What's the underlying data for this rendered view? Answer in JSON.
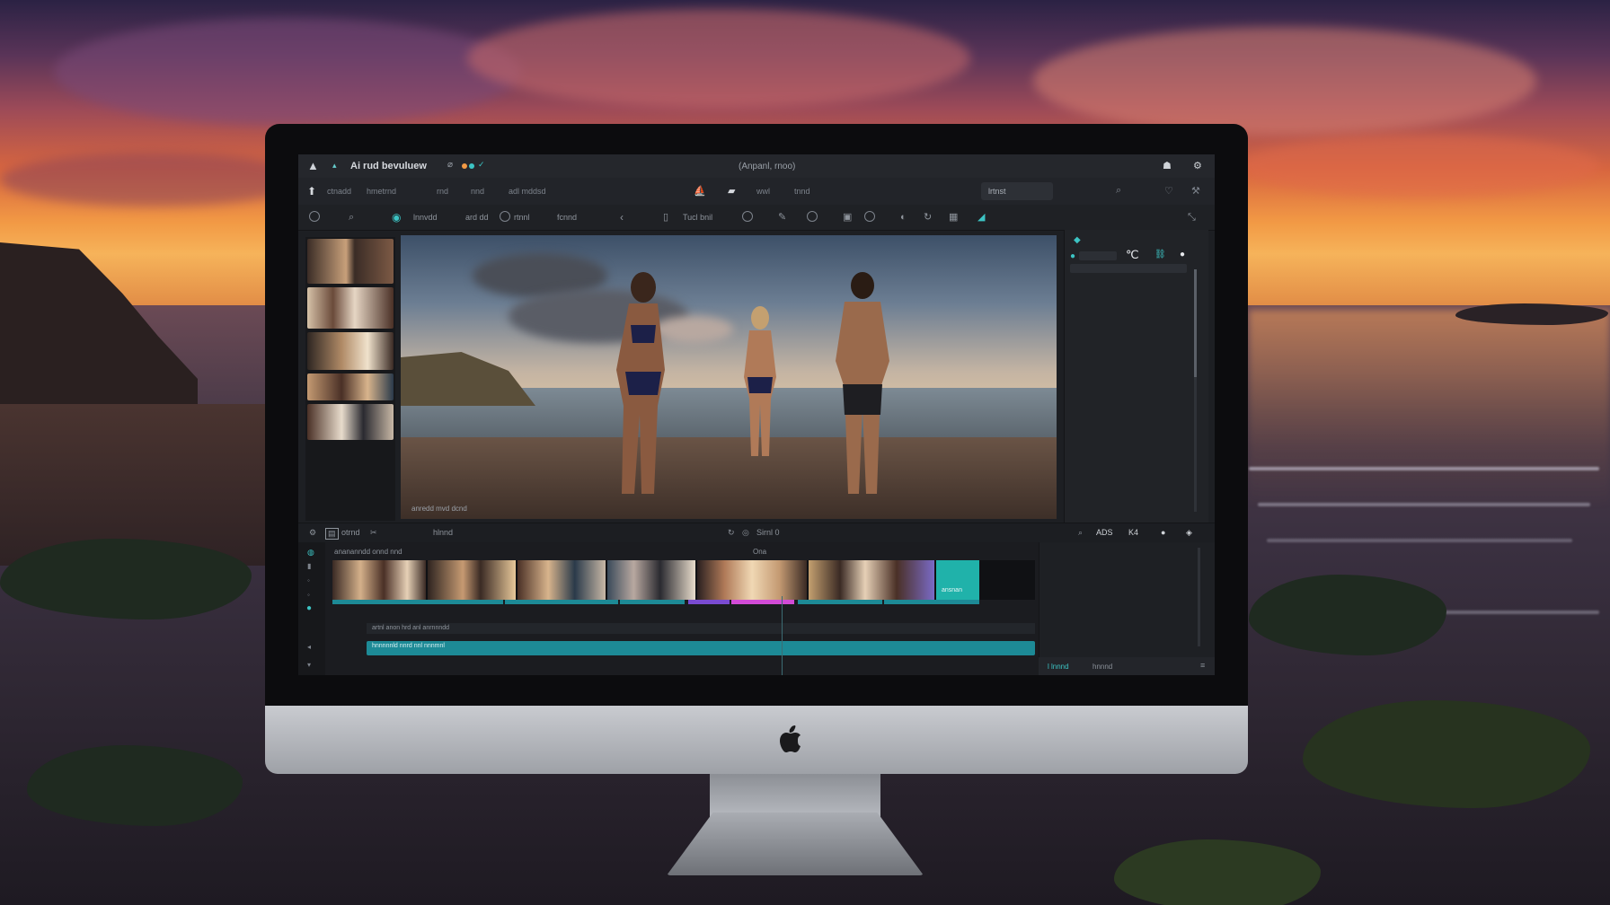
{
  "app": {
    "title": "Ai rud bevuluew",
    "document_title": "(Anpanl, rnoo)"
  },
  "menubar": {
    "items": [
      "ctnadd",
      "hmetrnd",
      "rnd",
      "nnd",
      "adl mddsd"
    ],
    "center_items": [
      "wwl",
      "tnnd"
    ],
    "right_chip": "lrtnst"
  },
  "toolbar": {
    "items": [
      "lnnvdd",
      "ard dd",
      "rtnnl",
      "fcnnd",
      "Tucl bnil"
    ]
  },
  "viewer": {
    "caption": "anredd mvd dcnd"
  },
  "transport": {
    "left_label": "otrnd",
    "center_label": "hlnnd",
    "timecode": "Sirnl 0",
    "right_labels": [
      "ADS",
      "K4"
    ]
  },
  "timeline": {
    "track_label": "anananndd onnd nnd",
    "marker_label": "Ona",
    "teal_clip_label": "ansnan",
    "sub_label": "artnl anon hrd anl anrnnndd",
    "audio_label": "hnnnnnld nnrd nnl nnnmnl",
    "side_footer": [
      "l lnnnd",
      "hnnnd"
    ]
  },
  "colors": {
    "accent": "#1d8a96",
    "teal_clip": "#20b2aa",
    "purple_marker": "#7a4bd1",
    "pink_marker": "#d24bd6"
  }
}
